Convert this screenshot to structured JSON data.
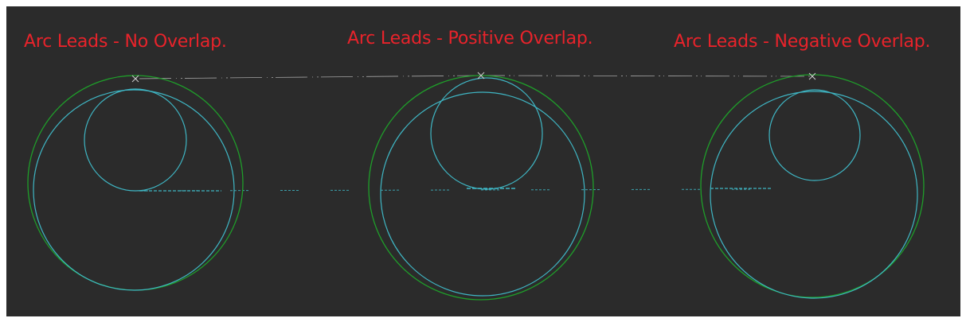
{
  "labels": {
    "no_overlap": "Arc Leads - No Overlap.",
    "positive_overlap": "Arc Leads - Positive Overlap.",
    "negative_overlap": "Arc Leads - Negative Overlap."
  },
  "colors": {
    "background": "#2b2b2b",
    "title": "#e8232b",
    "outer_circle": "#1f9e2a",
    "toolpath": "#3fb6c4",
    "rapid": "#d8d8d8",
    "start_marker": "#cfcfcf"
  }
}
